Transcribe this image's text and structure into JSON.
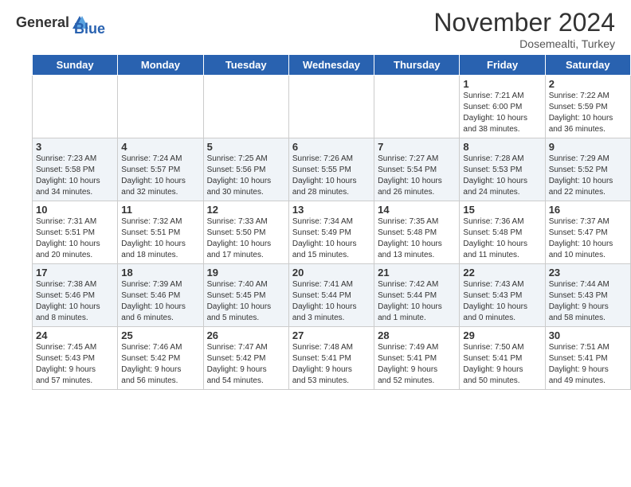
{
  "header": {
    "logo_line1": "General",
    "logo_line2": "Blue",
    "month_title": "November 2024",
    "location": "Dosemealti, Turkey"
  },
  "columns": [
    "Sunday",
    "Monday",
    "Tuesday",
    "Wednesday",
    "Thursday",
    "Friday",
    "Saturday"
  ],
  "weeks": [
    [
      {
        "day": "",
        "info": ""
      },
      {
        "day": "",
        "info": ""
      },
      {
        "day": "",
        "info": ""
      },
      {
        "day": "",
        "info": ""
      },
      {
        "day": "",
        "info": ""
      },
      {
        "day": "1",
        "info": "Sunrise: 7:21 AM\nSunset: 6:00 PM\nDaylight: 10 hours\nand 38 minutes."
      },
      {
        "day": "2",
        "info": "Sunrise: 7:22 AM\nSunset: 5:59 PM\nDaylight: 10 hours\nand 36 minutes."
      }
    ],
    [
      {
        "day": "3",
        "info": "Sunrise: 7:23 AM\nSunset: 5:58 PM\nDaylight: 10 hours\nand 34 minutes."
      },
      {
        "day": "4",
        "info": "Sunrise: 7:24 AM\nSunset: 5:57 PM\nDaylight: 10 hours\nand 32 minutes."
      },
      {
        "day": "5",
        "info": "Sunrise: 7:25 AM\nSunset: 5:56 PM\nDaylight: 10 hours\nand 30 minutes."
      },
      {
        "day": "6",
        "info": "Sunrise: 7:26 AM\nSunset: 5:55 PM\nDaylight: 10 hours\nand 28 minutes."
      },
      {
        "day": "7",
        "info": "Sunrise: 7:27 AM\nSunset: 5:54 PM\nDaylight: 10 hours\nand 26 minutes."
      },
      {
        "day": "8",
        "info": "Sunrise: 7:28 AM\nSunset: 5:53 PM\nDaylight: 10 hours\nand 24 minutes."
      },
      {
        "day": "9",
        "info": "Sunrise: 7:29 AM\nSunset: 5:52 PM\nDaylight: 10 hours\nand 22 minutes."
      }
    ],
    [
      {
        "day": "10",
        "info": "Sunrise: 7:31 AM\nSunset: 5:51 PM\nDaylight: 10 hours\nand 20 minutes."
      },
      {
        "day": "11",
        "info": "Sunrise: 7:32 AM\nSunset: 5:51 PM\nDaylight: 10 hours\nand 18 minutes."
      },
      {
        "day": "12",
        "info": "Sunrise: 7:33 AM\nSunset: 5:50 PM\nDaylight: 10 hours\nand 17 minutes."
      },
      {
        "day": "13",
        "info": "Sunrise: 7:34 AM\nSunset: 5:49 PM\nDaylight: 10 hours\nand 15 minutes."
      },
      {
        "day": "14",
        "info": "Sunrise: 7:35 AM\nSunset: 5:48 PM\nDaylight: 10 hours\nand 13 minutes."
      },
      {
        "day": "15",
        "info": "Sunrise: 7:36 AM\nSunset: 5:48 PM\nDaylight: 10 hours\nand 11 minutes."
      },
      {
        "day": "16",
        "info": "Sunrise: 7:37 AM\nSunset: 5:47 PM\nDaylight: 10 hours\nand 10 minutes."
      }
    ],
    [
      {
        "day": "17",
        "info": "Sunrise: 7:38 AM\nSunset: 5:46 PM\nDaylight: 10 hours\nand 8 minutes."
      },
      {
        "day": "18",
        "info": "Sunrise: 7:39 AM\nSunset: 5:46 PM\nDaylight: 10 hours\nand 6 minutes."
      },
      {
        "day": "19",
        "info": "Sunrise: 7:40 AM\nSunset: 5:45 PM\nDaylight: 10 hours\nand 5 minutes."
      },
      {
        "day": "20",
        "info": "Sunrise: 7:41 AM\nSunset: 5:44 PM\nDaylight: 10 hours\nand 3 minutes."
      },
      {
        "day": "21",
        "info": "Sunrise: 7:42 AM\nSunset: 5:44 PM\nDaylight: 10 hours\nand 1 minute."
      },
      {
        "day": "22",
        "info": "Sunrise: 7:43 AM\nSunset: 5:43 PM\nDaylight: 10 hours\nand 0 minutes."
      },
      {
        "day": "23",
        "info": "Sunrise: 7:44 AM\nSunset: 5:43 PM\nDaylight: 9 hours\nand 58 minutes."
      }
    ],
    [
      {
        "day": "24",
        "info": "Sunrise: 7:45 AM\nSunset: 5:43 PM\nDaylight: 9 hours\nand 57 minutes."
      },
      {
        "day": "25",
        "info": "Sunrise: 7:46 AM\nSunset: 5:42 PM\nDaylight: 9 hours\nand 56 minutes."
      },
      {
        "day": "26",
        "info": "Sunrise: 7:47 AM\nSunset: 5:42 PM\nDaylight: 9 hours\nand 54 minutes."
      },
      {
        "day": "27",
        "info": "Sunrise: 7:48 AM\nSunset: 5:41 PM\nDaylight: 9 hours\nand 53 minutes."
      },
      {
        "day": "28",
        "info": "Sunrise: 7:49 AM\nSunset: 5:41 PM\nDaylight: 9 hours\nand 52 minutes."
      },
      {
        "day": "29",
        "info": "Sunrise: 7:50 AM\nSunset: 5:41 PM\nDaylight: 9 hours\nand 50 minutes."
      },
      {
        "day": "30",
        "info": "Sunrise: 7:51 AM\nSunset: 5:41 PM\nDaylight: 9 hours\nand 49 minutes."
      }
    ]
  ]
}
